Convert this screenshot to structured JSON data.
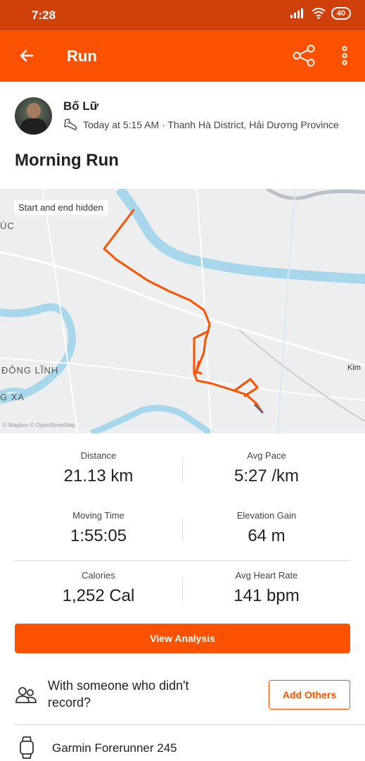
{
  "status_bar": {
    "time": "7:28",
    "battery": "40"
  },
  "app_bar": {
    "title": "Run"
  },
  "athlete": {
    "name": "Bố Lữ",
    "meta": "Today at 5:15 AM · Thanh Hà District, Hải Dương Province"
  },
  "activity": {
    "title": "Morning Run"
  },
  "map": {
    "badge": "Start and end hidden",
    "labels": {
      "l1": "ÚC",
      "l2": "ĐÔNG LĨNH",
      "l3": "G XA",
      "l4": "Kim"
    },
    "attribution": "© Mapbox © OpenStreetMap",
    "route_color": "#fc5200"
  },
  "stats": [
    {
      "left": {
        "label": "Distance",
        "value": "21.13 km"
      },
      "right": {
        "label": "Avg Pace",
        "value": "5:27 /km"
      }
    },
    {
      "left": {
        "label": "Moving Time",
        "value": "1:55:05"
      },
      "right": {
        "label": "Elevation Gain",
        "value": "64 m"
      }
    },
    {
      "left": {
        "label": "Calories",
        "value": "1,252 Cal"
      },
      "right": {
        "label": "Avg Heart Rate",
        "value": "141 bpm"
      }
    }
  ],
  "actions": {
    "view_analysis": "View Analysis",
    "add_others": "Add Others"
  },
  "others_prompt": "With someone who didn't record?",
  "device": {
    "name": "Garmin Forerunner 245"
  },
  "colors": {
    "brand": "#fc5200",
    "status_bar": "#d0400a"
  }
}
